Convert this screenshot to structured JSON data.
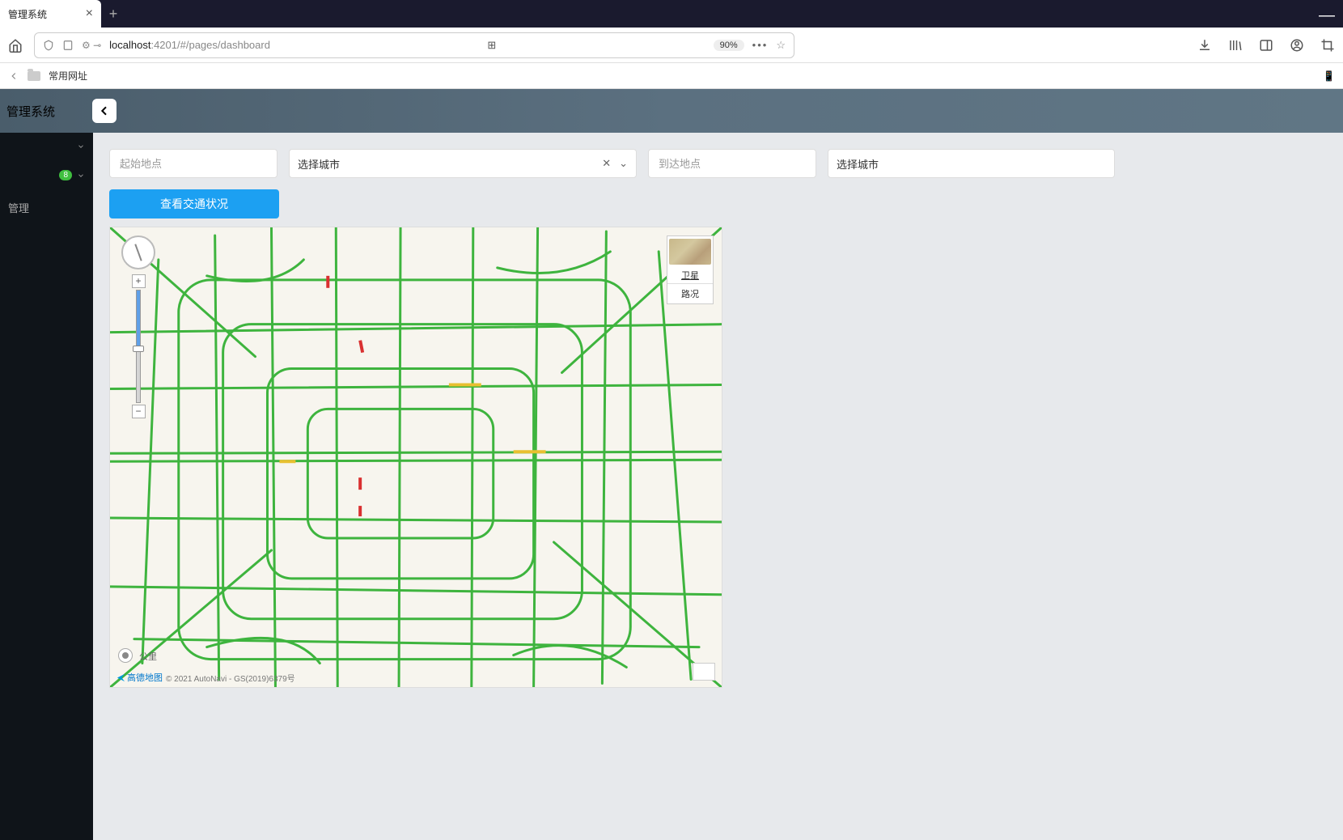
{
  "browser": {
    "tab_title": "管理系统",
    "url_host": "localhost",
    "url_port": ":4201",
    "url_path": "/#/pages/dashboard",
    "zoom": "90%"
  },
  "bookmarks": {
    "folder1": "常用网址"
  },
  "app": {
    "title": "管理系统"
  },
  "sidebar": {
    "badge": "8",
    "item_manage": "管理"
  },
  "controls": {
    "start_placeholder": "起始地点",
    "end_placeholder": "到达地点",
    "city_select1": "选择城市",
    "city_select2": "选择城市",
    "traffic_btn": "查看交通状况"
  },
  "map": {
    "layer_satellite": "卫星",
    "layer_traffic": "路况",
    "scale": "公里",
    "provider": "高德地图",
    "copyright": "© 2021 AutoNavi - GS(2019)6379号"
  }
}
